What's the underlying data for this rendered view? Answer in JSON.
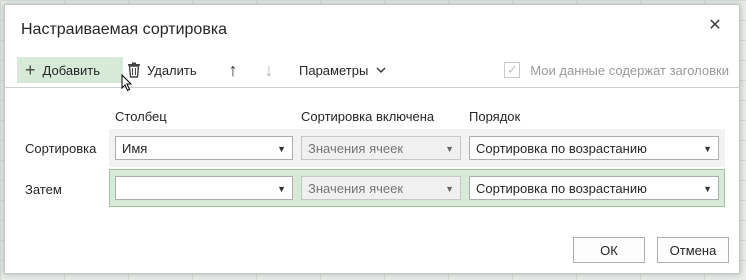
{
  "dialog": {
    "title": "Настраиваемая сортировка",
    "close_icon": "close-icon"
  },
  "toolbar": {
    "add_label": "Добавить",
    "delete_label": "Удалить",
    "params_label": "Параметры",
    "headers_label": "Мои данные содержат заголовки",
    "headers_checked": true
  },
  "columns": {
    "column": "Столбец",
    "sort_on": "Сортировка включена",
    "order": "Порядок"
  },
  "rows": [
    {
      "label": "Сортировка",
      "column": "Имя",
      "sort_on": "Значения ячеек",
      "order": "Сортировка по возрастанию"
    },
    {
      "label": "Затем",
      "column": "",
      "sort_on": "Значения ячеек",
      "order": "Сортировка по возрастанию"
    }
  ],
  "footer": {
    "ok_label": "ОК",
    "cancel_label": "Отмена"
  },
  "colors": {
    "accent_green": "#d7ead8",
    "selected_row_border": "#9dc59f"
  }
}
